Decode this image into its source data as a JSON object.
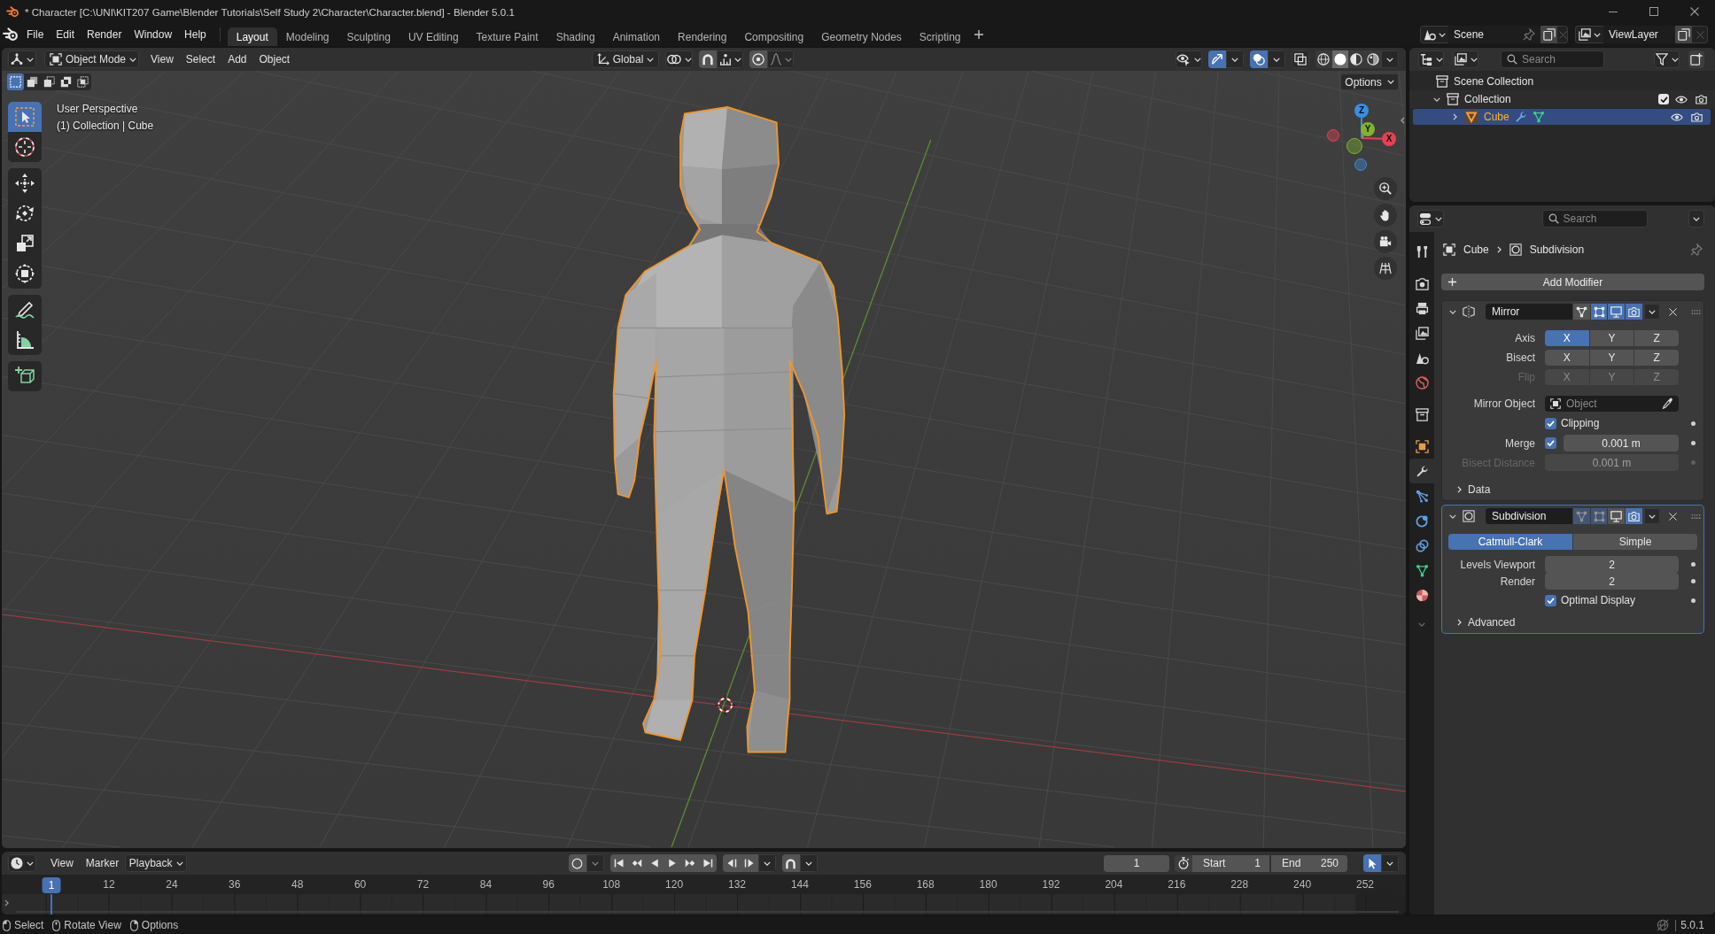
{
  "window": {
    "title": "* Character [C:\\UNI\\KIT207 Game\\Blender Tutorials\\Self Study 2\\Character\\Character.blend] - Blender 5.0.1"
  },
  "menu": [
    "File",
    "Edit",
    "Render",
    "Window",
    "Help"
  ],
  "workspaces": [
    {
      "label": "Layout",
      "selected": true
    },
    {
      "label": "Modeling",
      "selected": false
    },
    {
      "label": "Sculpting",
      "selected": false
    },
    {
      "label": "UV Editing",
      "selected": false
    },
    {
      "label": "Texture Paint",
      "selected": false
    },
    {
      "label": "Shading",
      "selected": false
    },
    {
      "label": "Animation",
      "selected": false
    },
    {
      "label": "Rendering",
      "selected": false
    },
    {
      "label": "Compositing",
      "selected": false
    },
    {
      "label": "Geometry Nodes",
      "selected": false
    },
    {
      "label": "Scripting",
      "selected": false
    }
  ],
  "scene": {
    "name": "Scene"
  },
  "view_layer": {
    "name": "ViewLayer"
  },
  "viewport": {
    "header": {
      "mode": "Object Mode",
      "menus": [
        "View",
        "Select",
        "Add",
        "Object"
      ],
      "orientation": "Global",
      "snapping": false,
      "proportional_editing": false,
      "gizmos": true,
      "overlays": true,
      "xray": false,
      "shading": [
        {
          "kind": "wireframe",
          "selected": false
        },
        {
          "kind": "solid",
          "selected": true
        },
        {
          "kind": "material",
          "selected": false
        },
        {
          "kind": "rendered",
          "selected": false
        }
      ]
    },
    "select_modes": [
      {
        "kind": "new",
        "selected": true
      },
      {
        "kind": "extend",
        "selected": false
      },
      {
        "kind": "subtract",
        "selected": false
      },
      {
        "kind": "invert",
        "selected": false
      },
      {
        "kind": "intersect",
        "selected": false
      }
    ],
    "options": "Options",
    "info": [
      "User Perspective",
      "(1) Collection | Cube"
    ],
    "toolbar": [
      [
        {
          "kind": "select",
          "selected": true
        },
        {
          "kind": "cursor",
          "selected": false
        }
      ],
      [
        {
          "kind": "move",
          "selected": false
        },
        {
          "kind": "rotate",
          "selected": false
        },
        {
          "kind": "scale",
          "selected": false
        },
        {
          "kind": "transform",
          "selected": false
        }
      ],
      [
        {
          "kind": "annotate",
          "selected": false
        },
        {
          "kind": "measure",
          "selected": false
        }
      ],
      [
        {
          "kind": "cube",
          "selected": false
        }
      ]
    ],
    "gizmo": {
      "axes": [
        {
          "label": "X",
          "color": "#e8414f"
        },
        {
          "label": "Y",
          "color": "#7fb52c"
        },
        {
          "label": "Z",
          "color": "#3a8ee0"
        }
      ]
    }
  },
  "outliner": {
    "search_placeholder": "Search",
    "tree": [
      {
        "kind": "scene_collection",
        "label": "Scene Collection",
        "selected": false,
        "children": [
          {
            "kind": "collection",
            "label": "Collection",
            "selected": false,
            "expanded": true,
            "checked": true,
            "children": [
              {
                "kind": "mesh",
                "label": "Cube",
                "selected": true,
                "expanded": false
              }
            ]
          }
        ]
      }
    ]
  },
  "properties": {
    "search_placeholder": "Search",
    "tabs": [
      [
        {
          "kind": "tool",
          "selected": false
        }
      ],
      [
        {
          "kind": "render",
          "selected": false
        },
        {
          "kind": "output",
          "selected": false
        },
        {
          "kind": "view_layer",
          "selected": false
        },
        {
          "kind": "scene",
          "selected": false
        },
        {
          "kind": "world",
          "selected": false
        }
      ],
      [
        {
          "kind": "collection",
          "selected": false
        }
      ],
      [
        {
          "kind": "object",
          "selected": false
        },
        {
          "kind": "modifiers",
          "selected": true
        },
        {
          "kind": "particles",
          "selected": false
        },
        {
          "kind": "physics",
          "selected": false
        },
        {
          "kind": "constraints",
          "selected": false
        },
        {
          "kind": "data",
          "selected": false
        },
        {
          "kind": "material",
          "selected": false
        }
      ]
    ],
    "breadcrumb": [
      "Cube",
      "Subdivision"
    ],
    "add_modifier": "Add Modifier",
    "modifiers": [
      {
        "kind": "mirror",
        "name": "Mirror",
        "expanded": true,
        "active": false,
        "toggles": [
          {
            "kind": "on_cage",
            "on": false,
            "disabled": false
          },
          {
            "kind": "edit_mode",
            "on": true,
            "disabled": false
          },
          {
            "kind": "viewport",
            "on": true,
            "disabled": false
          },
          {
            "kind": "render",
            "on": true,
            "disabled": false
          }
        ],
        "rows": [
          {
            "kind": "toggles",
            "label": "Axis",
            "disabled": false,
            "options": [
              {
                "label": "X",
                "selected": true
              },
              {
                "label": "Y",
                "selected": false
              },
              {
                "label": "Z",
                "selected": false
              }
            ]
          },
          {
            "kind": "toggles",
            "label": "Bisect",
            "disabled": false,
            "options": [
              {
                "label": "X",
                "selected": false
              },
              {
                "label": "Y",
                "selected": false
              },
              {
                "label": "Z",
                "selected": false
              }
            ]
          },
          {
            "kind": "toggles",
            "label": "Flip",
            "disabled": true,
            "options": [
              {
                "label": "X",
                "selected": false
              },
              {
                "label": "Y",
                "selected": false
              },
              {
                "label": "Z",
                "selected": false
              }
            ]
          },
          {
            "kind": "object",
            "label": "Mirror Object",
            "placeholder": "Object"
          },
          {
            "kind": "checkbox",
            "label": "Clipping",
            "checked": true
          },
          {
            "kind": "checked_number",
            "label": "Merge",
            "checked": true,
            "value": "0.001 m"
          },
          {
            "kind": "number",
            "label": "Bisect Distance",
            "value": "0.001 m",
            "disabled": true
          },
          {
            "kind": "subpanel",
            "label": "Data",
            "expanded": false
          }
        ]
      },
      {
        "kind": "subdivision",
        "name": "Subdivision",
        "expanded": true,
        "active": true,
        "toggles": [
          {
            "kind": "on_cage",
            "on": true,
            "disabled": true
          },
          {
            "kind": "edit_mode",
            "on": true,
            "disabled": true
          },
          {
            "kind": "viewport",
            "on": false,
            "disabled": false
          },
          {
            "kind": "render",
            "on": true,
            "disabled": false
          }
        ],
        "rows": [
          {
            "kind": "choice",
            "options": [
              {
                "label": "Catmull-Clark",
                "selected": true
              },
              {
                "label": "Simple",
                "selected": false
              }
            ]
          },
          {
            "kind": "number",
            "label": "Levels Viewport",
            "value": "2",
            "disabled": false
          },
          {
            "kind": "number",
            "label": "Render",
            "value": "2",
            "disabled": false
          },
          {
            "kind": "checkbox",
            "label": "Optimal Display",
            "checked": true
          },
          {
            "kind": "subpanel",
            "label": "Advanced",
            "expanded": false
          }
        ]
      }
    ]
  },
  "timeline": {
    "menus": [
      "View",
      "Marker"
    ],
    "playback": "Playback",
    "auto_keying": false,
    "snapping": false,
    "current_frame": "1",
    "start_label": "Start",
    "start": "1",
    "end_label": "End",
    "end": "250",
    "only_selected": true,
    "playhead": "1",
    "ruler": [
      "12",
      "24",
      "36",
      "48",
      "60",
      "72",
      "84",
      "96",
      "108",
      "120",
      "132",
      "144",
      "156",
      "168",
      "180",
      "192",
      "204",
      "216",
      "228",
      "240",
      "252"
    ]
  },
  "status_bar": {
    "hints": [
      {
        "kind": "left_click",
        "label": "Select"
      },
      {
        "kind": "middle_click",
        "label": "Rotate View"
      },
      {
        "kind": "right_click",
        "label": "Options"
      }
    ],
    "version": "5.0.1"
  }
}
